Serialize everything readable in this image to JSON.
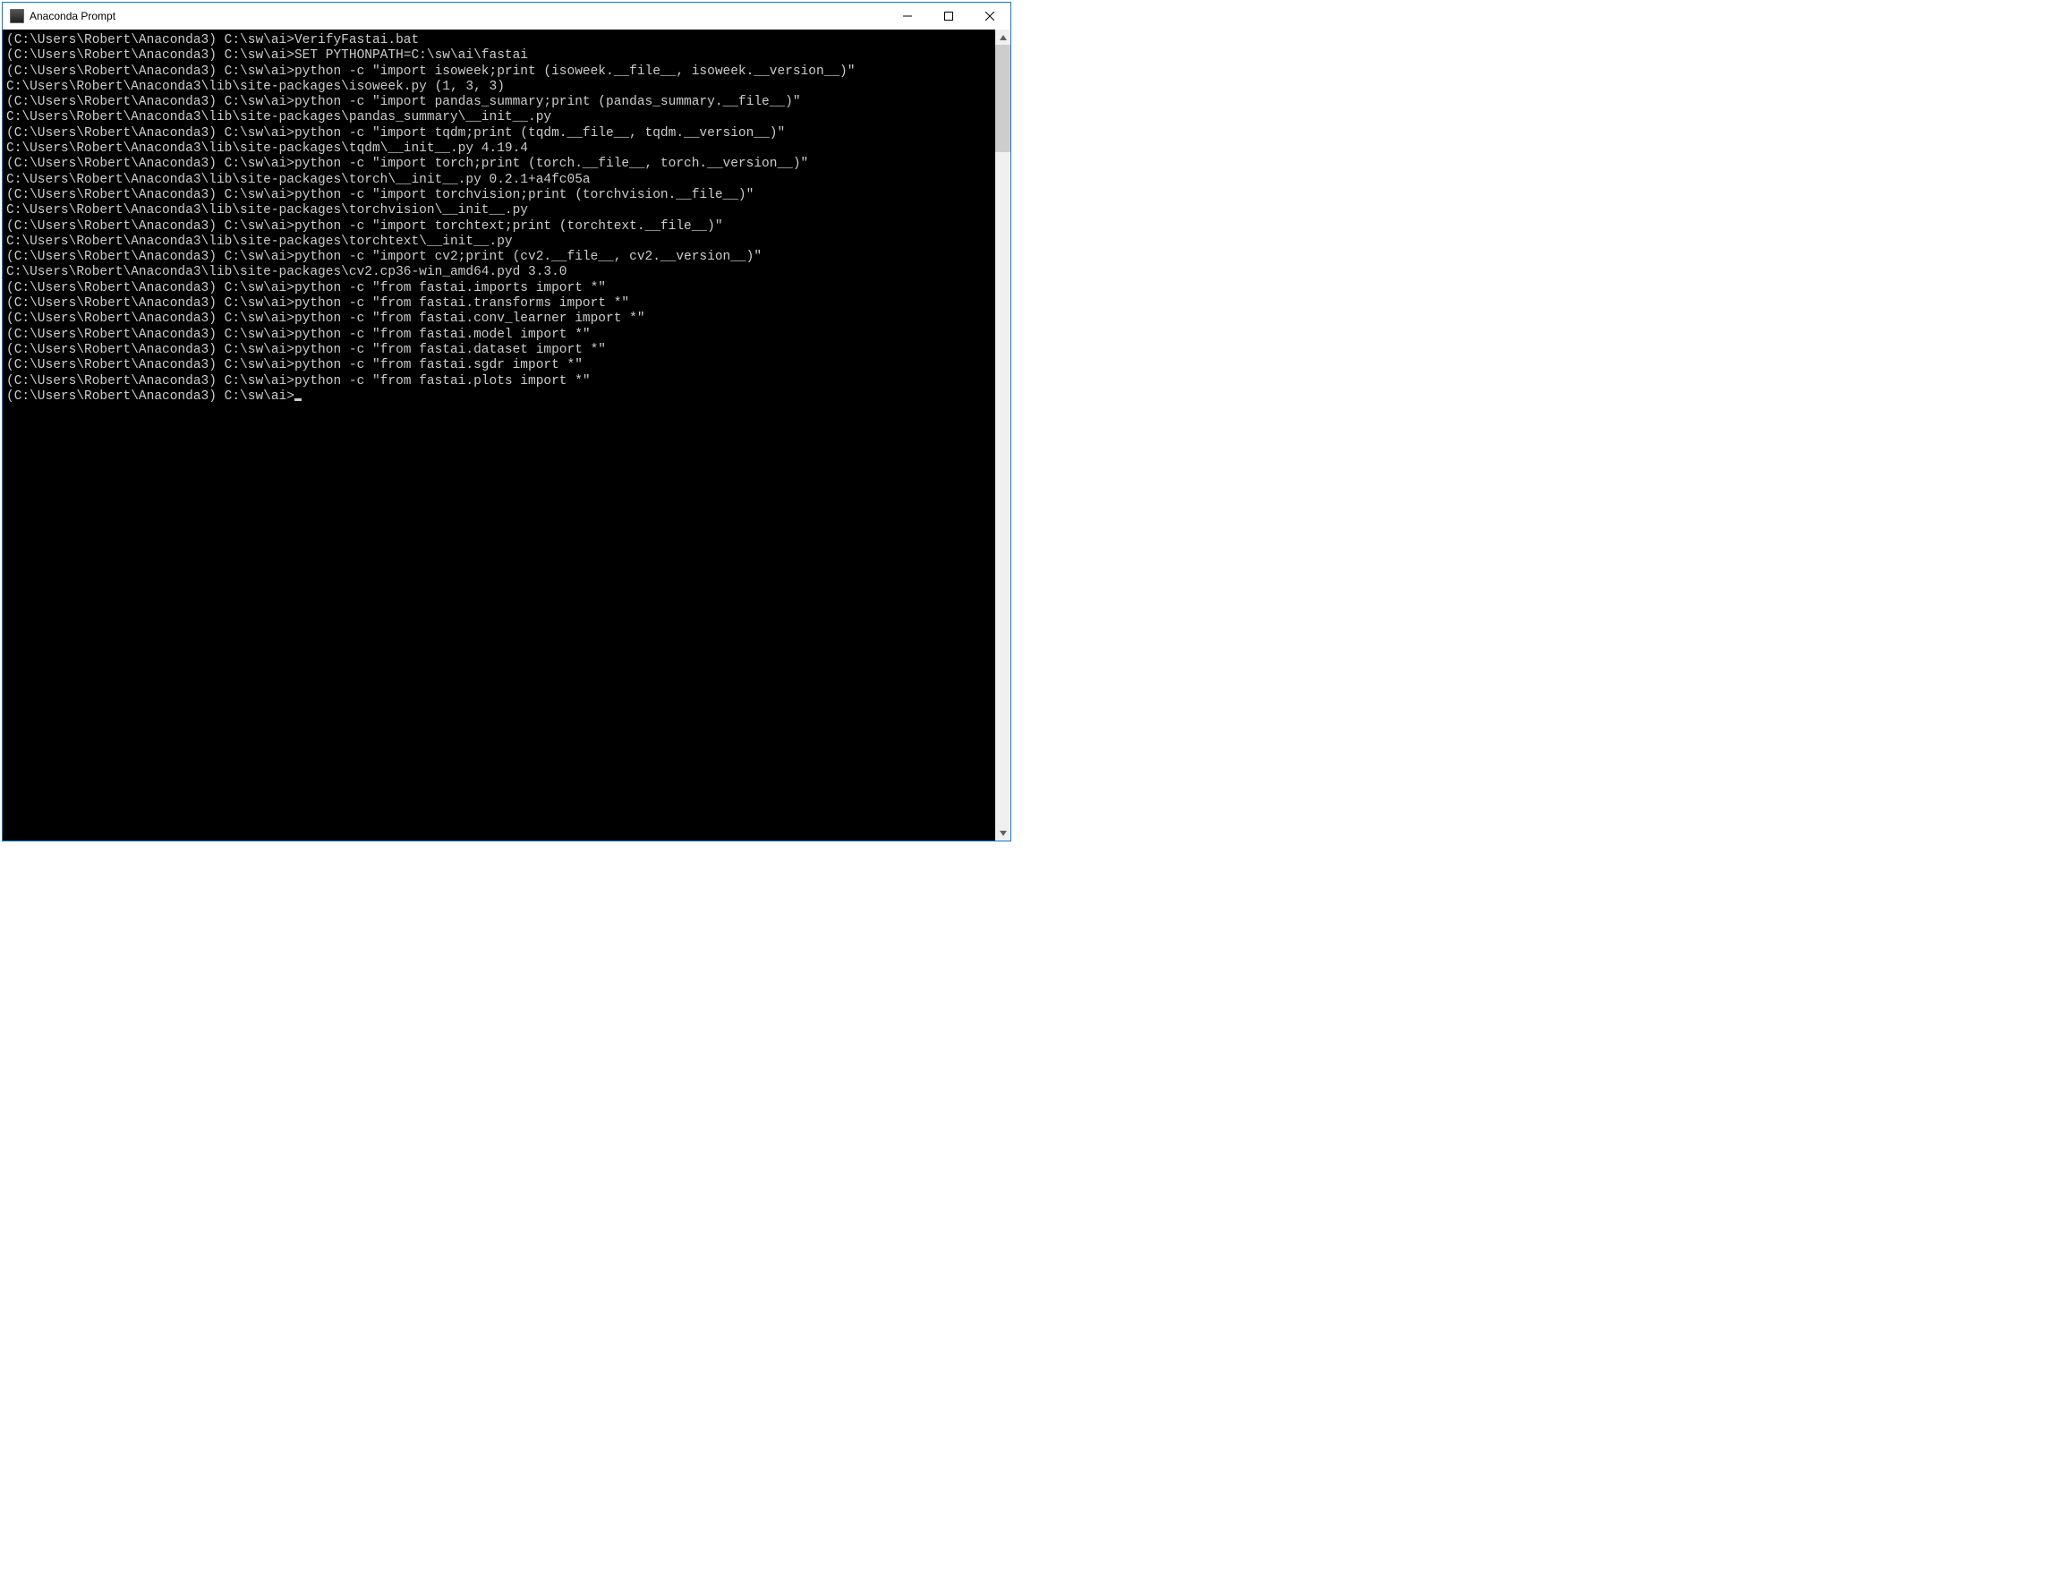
{
  "window": {
    "title": "Anaconda Prompt"
  },
  "prompt": "(C:\\Users\\Robert\\Anaconda3) C:\\sw\\ai>",
  "terminal": {
    "lines": [
      "",
      "(C:\\Users\\Robert\\Anaconda3) C:\\sw\\ai>VerifyFastai.bat",
      "",
      "(C:\\Users\\Robert\\Anaconda3) C:\\sw\\ai>SET PYTHONPATH=C:\\sw\\ai\\fastai",
      "",
      "(C:\\Users\\Robert\\Anaconda3) C:\\sw\\ai>python -c \"import isoweek;print (isoweek.__file__, isoweek.__version__)\"",
      "C:\\Users\\Robert\\Anaconda3\\lib\\site-packages\\isoweek.py (1, 3, 3)",
      "",
      "(C:\\Users\\Robert\\Anaconda3) C:\\sw\\ai>python -c \"import pandas_summary;print (pandas_summary.__file__)\"",
      "C:\\Users\\Robert\\Anaconda3\\lib\\site-packages\\pandas_summary\\__init__.py",
      "",
      "(C:\\Users\\Robert\\Anaconda3) C:\\sw\\ai>python -c \"import tqdm;print (tqdm.__file__, tqdm.__version__)\"",
      "C:\\Users\\Robert\\Anaconda3\\lib\\site-packages\\tqdm\\__init__.py 4.19.4",
      "",
      "(C:\\Users\\Robert\\Anaconda3) C:\\sw\\ai>python -c \"import torch;print (torch.__file__, torch.__version__)\"",
      "C:\\Users\\Robert\\Anaconda3\\lib\\site-packages\\torch\\__init__.py 0.2.1+a4fc05a",
      "",
      "(C:\\Users\\Robert\\Anaconda3) C:\\sw\\ai>python -c \"import torchvision;print (torchvision.__file__)\"",
      "C:\\Users\\Robert\\Anaconda3\\lib\\site-packages\\torchvision\\__init__.py",
      "",
      "(C:\\Users\\Robert\\Anaconda3) C:\\sw\\ai>python -c \"import torchtext;print (torchtext.__file__)\"",
      "C:\\Users\\Robert\\Anaconda3\\lib\\site-packages\\torchtext\\__init__.py",
      "",
      "(C:\\Users\\Robert\\Anaconda3) C:\\sw\\ai>python -c \"import cv2;print (cv2.__file__, cv2.__version__)\"",
      "C:\\Users\\Robert\\Anaconda3\\lib\\site-packages\\cv2.cp36-win_amd64.pyd 3.3.0",
      "",
      "(C:\\Users\\Robert\\Anaconda3) C:\\sw\\ai>python -c \"from fastai.imports import *\"",
      "",
      "(C:\\Users\\Robert\\Anaconda3) C:\\sw\\ai>python -c \"from fastai.transforms import *\"",
      "",
      "(C:\\Users\\Robert\\Anaconda3) C:\\sw\\ai>python -c \"from fastai.conv_learner import *\"",
      "",
      "(C:\\Users\\Robert\\Anaconda3) C:\\sw\\ai>python -c \"from fastai.model import *\"",
      "",
      "(C:\\Users\\Robert\\Anaconda3) C:\\sw\\ai>python -c \"from fastai.dataset import *\"",
      "",
      "(C:\\Users\\Robert\\Anaconda3) C:\\sw\\ai>python -c \"from fastai.sgdr import *\"",
      "",
      "(C:\\Users\\Robert\\Anaconda3) C:\\sw\\ai>python -c \"from fastai.plots import *\"",
      "",
      "(C:\\Users\\Robert\\Anaconda3) C:\\sw\\ai>"
    ]
  }
}
